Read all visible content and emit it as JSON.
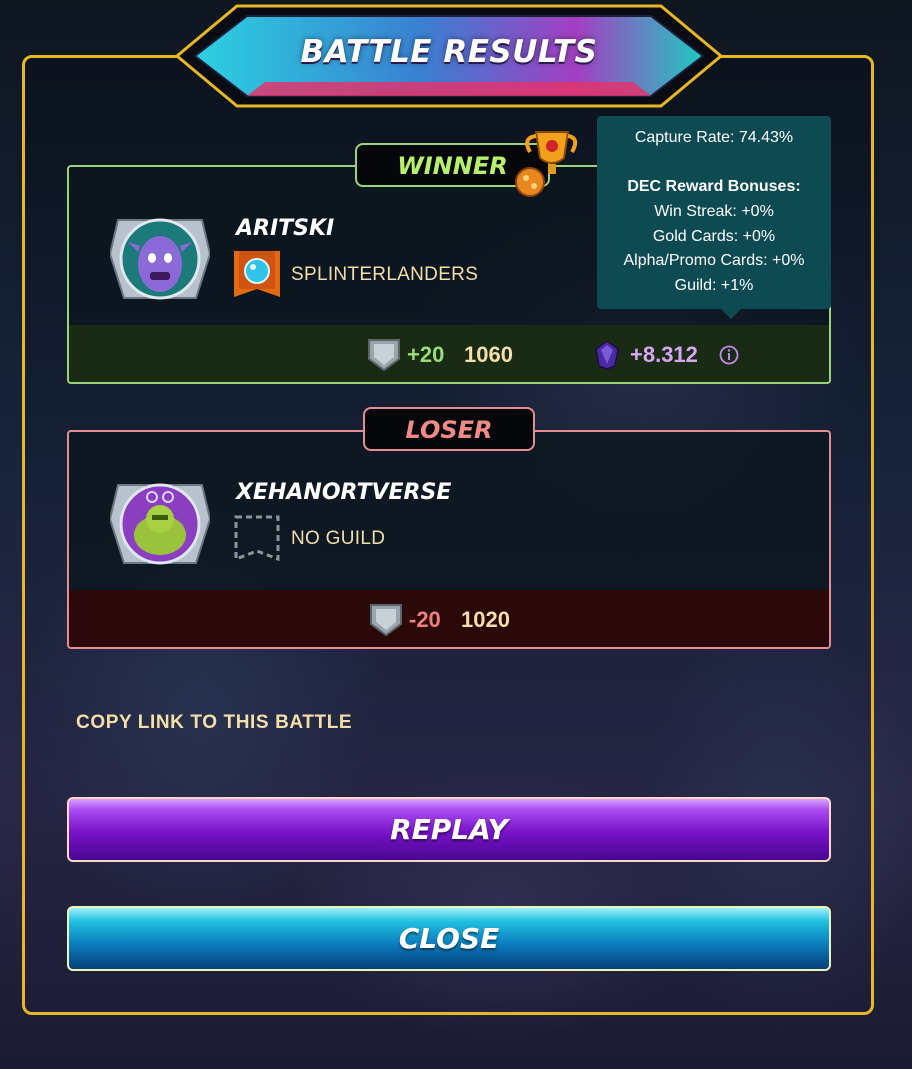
{
  "title": "BATTLE RESULTS",
  "winner": {
    "tag": "WINNER",
    "name": "ARITSKI",
    "guild": "SPLINTERLANDERS",
    "rating_change": "+20",
    "rating": "1060",
    "dec_reward": "+8.312"
  },
  "loser": {
    "tag": "LOSER",
    "name": "XEHANORTVERSE",
    "guild": "NO GUILD",
    "rating_change": "-20",
    "rating": "1020"
  },
  "tooltip": {
    "capture_rate": "Capture Rate: 74.43%",
    "bonuses_heading": "DEC Reward Bonuses:",
    "win_streak": "Win Streak: +0%",
    "gold_cards": "Gold Cards: +0%",
    "alpha_promo": "Alpha/Promo Cards: +0%",
    "guild": "Guild: +1%"
  },
  "copy_link_label": "COPY LINK TO THIS BATTLE",
  "buttons": {
    "replay": "REPLAY",
    "close": "CLOSE"
  },
  "icons": {
    "trophy": "trophy-icon",
    "rating": "rating-shield-icon",
    "dec": "dec-crystal-icon",
    "info": "info-icon",
    "guild_banner": "guild-banner-icon",
    "no_guild": "no-guild-icon"
  },
  "colors": {
    "modal_border": "#e7b824",
    "winner": "#9bd37b",
    "loser": "#e68d93",
    "replay": "#7612c7",
    "close": "#0c7fbf"
  }
}
